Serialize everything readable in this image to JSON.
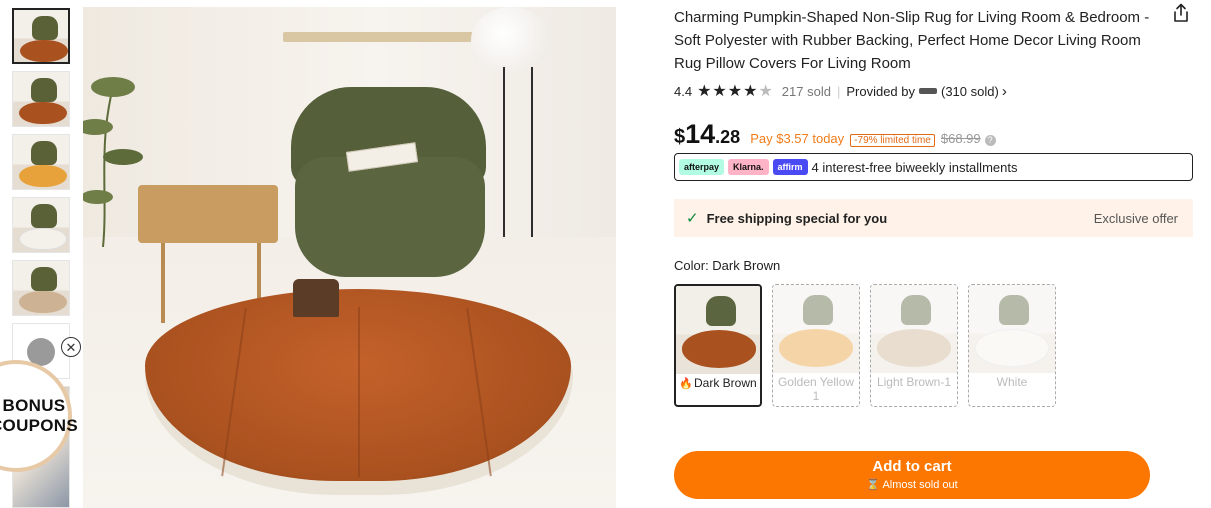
{
  "product": {
    "title": "Charming Pumpkin-Shaped Non-Slip Rug for Living Room & Bedroom - Soft Polyester with Rubber Backing, Perfect Home Decor Living Room Rug Pillow Covers For Living Room",
    "rating_value": "4.4",
    "stars": 4.4,
    "sold_count": "217 sold",
    "provided_by_label": "Provided by",
    "seller_sold": "(310 sold)"
  },
  "price": {
    "currency": "$",
    "integer": "14",
    "decimal": ".28",
    "pay_today": "Pay $3.57 today",
    "discount_badge": "-79% limited time",
    "original": "$68.99"
  },
  "bnpl": {
    "logos": [
      "afterpay",
      "Klarna.",
      "affirm"
    ],
    "text": "4 interest-free biweekly installments"
  },
  "shipping": {
    "text": "Free shipping special for you",
    "exclusive": "Exclusive offer"
  },
  "color": {
    "label": "Color: Dark Brown",
    "options": [
      {
        "name": "Dark Brown",
        "rug_color": "#a9511f",
        "selected": true,
        "available": true
      },
      {
        "name": "Golden Yellow 1",
        "rug_color": "#e8a23c",
        "selected": false,
        "available": false
      },
      {
        "name": "Light Brown-1",
        "rug_color": "#cdb394",
        "selected": false,
        "available": false
      },
      {
        "name": "White",
        "rug_color": "#f4f1ea",
        "selected": false,
        "available": false
      }
    ]
  },
  "cart": {
    "label": "Add to cart",
    "sub": "Almost sold out"
  },
  "promo": {
    "line1": "BONUS",
    "line2": "COUPONS"
  },
  "thumbnails": [
    "#a9511f",
    "#a9511f",
    "#e8a23c",
    "#f4f1ea",
    "#cdb394",
    "swatch",
    "photo"
  ],
  "colors": {
    "accent": "#fb7701",
    "price_orange": "#f07c1a",
    "shipping_bg": "#fff3e9",
    "check_green": "#0a8a3a"
  }
}
